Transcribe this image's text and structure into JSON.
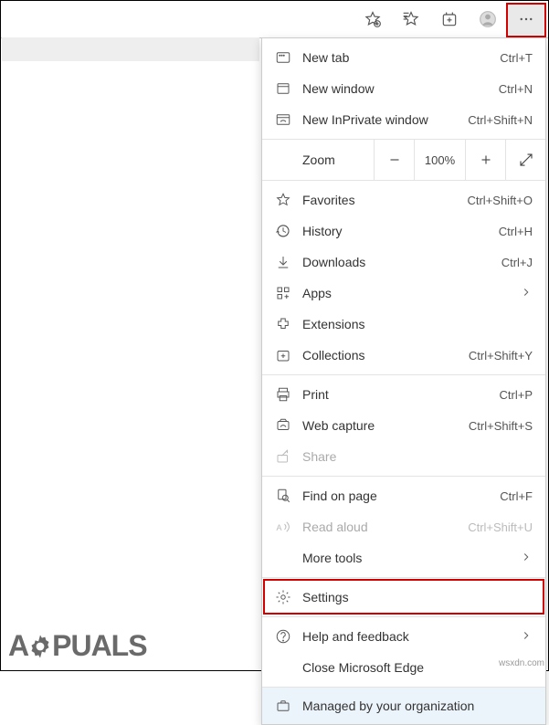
{
  "toolbar": {
    "icons": [
      "page-action-icon",
      "favorites-icon",
      "collections-icon",
      "profile-icon",
      "more-icon"
    ]
  },
  "menu": {
    "new_tab": {
      "label": "New tab",
      "shortcut": "Ctrl+T"
    },
    "new_window": {
      "label": "New window",
      "shortcut": "Ctrl+N"
    },
    "new_inprivate": {
      "label": "New InPrivate window",
      "shortcut": "Ctrl+Shift+N"
    },
    "zoom": {
      "label": "Zoom",
      "value": "100%"
    },
    "favorites": {
      "label": "Favorites",
      "shortcut": "Ctrl+Shift+O"
    },
    "history": {
      "label": "History",
      "shortcut": "Ctrl+H"
    },
    "downloads": {
      "label": "Downloads",
      "shortcut": "Ctrl+J"
    },
    "apps": {
      "label": "Apps"
    },
    "extensions": {
      "label": "Extensions"
    },
    "collections": {
      "label": "Collections",
      "shortcut": "Ctrl+Shift+Y"
    },
    "print": {
      "label": "Print",
      "shortcut": "Ctrl+P"
    },
    "webcapture": {
      "label": "Web capture",
      "shortcut": "Ctrl+Shift+S"
    },
    "share": {
      "label": "Share"
    },
    "find": {
      "label": "Find on page",
      "shortcut": "Ctrl+F"
    },
    "readaloud": {
      "label": "Read aloud",
      "shortcut": "Ctrl+Shift+U"
    },
    "moretools": {
      "label": "More tools"
    },
    "settings": {
      "label": "Settings"
    },
    "help": {
      "label": "Help and feedback"
    },
    "close": {
      "label": "Close Microsoft Edge"
    },
    "managed": {
      "label": "Managed by your organization"
    }
  },
  "watermark": {
    "part1": "A",
    "part2": "PUALS"
  },
  "source": "wsxdn.com"
}
